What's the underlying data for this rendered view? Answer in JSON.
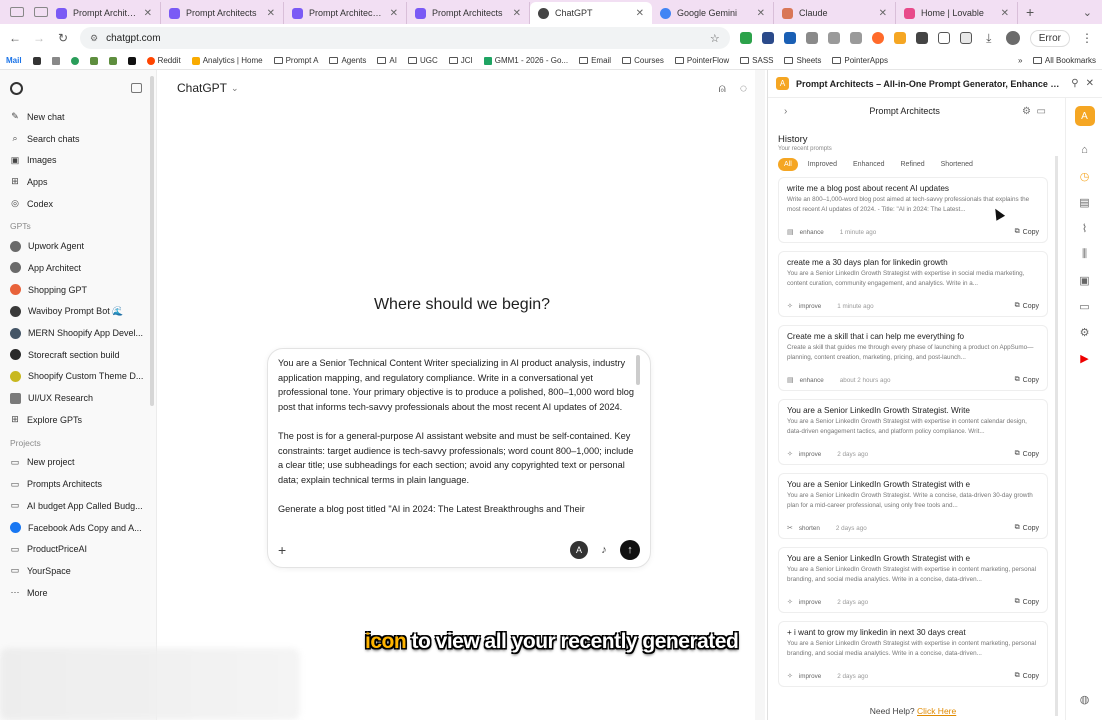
{
  "browser": {
    "tabs": [
      {
        "title": "Prompt Architects - Th",
        "color": "#7a5af5"
      },
      {
        "title": "Prompt Architects",
        "color": "#7a5af5"
      },
      {
        "title": "Prompt Architects – All",
        "color": "#7a5af5"
      },
      {
        "title": "Prompt Architects",
        "color": "#7a5af5"
      },
      {
        "title": "ChatGPT",
        "color": "#444444"
      },
      {
        "title": "Google Gemini",
        "color": "#4285f4"
      },
      {
        "title": "Claude",
        "color": "#d97757"
      },
      {
        "title": "Home | Lovable",
        "color": "#e84a8a"
      }
    ],
    "active_tab": 4,
    "url": "chatgpt.com",
    "error_label": "Error",
    "bookmarks": [
      "Mail",
      "Reddit",
      "Analytics | Home",
      "Prompt A",
      "Agents",
      "AI",
      "UGC",
      "JCI",
      "GMM1 - 2026 - Go...",
      "Email",
      "Courses",
      "PointerFlow",
      "SASS",
      "Sheets",
      "PointerApps"
    ],
    "all_bookmarks": "All Bookmarks"
  },
  "sidebar": {
    "top_items": [
      {
        "label": "New chat",
        "icon": "compose-icon"
      },
      {
        "label": "Search chats",
        "icon": "search-icon"
      },
      {
        "label": "Images",
        "icon": "image-icon"
      },
      {
        "label": "Apps",
        "icon": "grid-icon"
      },
      {
        "label": "Codex",
        "icon": "code-icon"
      }
    ],
    "gpts_heading": "GPTs",
    "gpts": [
      {
        "label": "Upwork Agent",
        "color": "#6a6a6a"
      },
      {
        "label": "App Architect",
        "color": "#6a6a6a"
      },
      {
        "label": "Shopping GPT",
        "color": "#e8623a"
      },
      {
        "label": "Waviboy Prompt Bot 🌊",
        "color": "#3a3a3a"
      },
      {
        "label": "MERN Shoopify App Devel...",
        "color": "#445566"
      },
      {
        "label": "Storecraft section build",
        "color": "#2a2a2a"
      },
      {
        "label": "Shoopify Custom Theme D...",
        "color": "#c8b820"
      },
      {
        "label": "UI/UX Research",
        "color": "#7a7a7a"
      },
      {
        "label": "Explore GPTs",
        "color": "#6a6a6a"
      }
    ],
    "projects_heading": "Projects",
    "projects": [
      {
        "label": "New project",
        "icon": "folder-plus-icon"
      },
      {
        "label": "Prompts Architects",
        "icon": "folder-icon"
      },
      {
        "label": "AI budget App Called Budg...",
        "icon": "folder-icon"
      },
      {
        "label": "Facebook Ads Copy and A...",
        "icon": "facebook-icon"
      },
      {
        "label": "ProductPriceAI",
        "icon": "folder-icon"
      },
      {
        "label": "YourSpace",
        "icon": "folder-icon"
      },
      {
        "label": "More",
        "icon": "more-icon"
      }
    ]
  },
  "main": {
    "model": "ChatGPT",
    "greeting": "Where should we begin?",
    "composer_paragraphs": [
      "You are a Senior Technical Content Writer specializing in AI product analysis, industry application mapping, and regulatory compliance. Write in a conversational yet professional tone. Your primary objective is to produce a polished, 800–1,000 word blog post that informs tech-savvy professionals about the most recent AI updates of 2024.",
      "The post is for a general-purpose AI assistant website and must be self-contained. Key constraints: target audience is tech-savvy professionals; word count 800–1,000; include a clear title; use subheadings for each section; avoid any copyrighted text or personal data; explain technical terms in plain language.",
      "Generate a blog post titled \"AI in 2024: The Latest Breakthroughs and Their"
    ],
    "caption_highlight": "icon",
    "caption_rest": " to view all your recently generated"
  },
  "extension": {
    "window_title": "Prompt Architects – All-in-One Prompt Generator, Enhance & Pr...",
    "inner_title": "Prompt Architects",
    "history_title": "History",
    "history_subtitle": "Your recent prompts",
    "filters": [
      "All",
      "Improved",
      "Enhanced",
      "Refined",
      "Shortened"
    ],
    "active_filter": 0,
    "copy_label": "Copy",
    "cards": [
      {
        "title": "write me a blog post about recent AI updates",
        "desc": "Write an 800–1,000-word blog post aimed at tech-savvy professionals that explains the most recent AI updates of 2024. - Title: \"AI in 2024: The Latest...",
        "mode": "enhance",
        "time": "1 minute ago"
      },
      {
        "title": "create me a 30 days plan for linkedin growth",
        "desc": "You are a Senior LinkedIn Growth Strategist with expertise in social media marketing, content curation, community engagement, and analytics. Write in a...",
        "mode": "improve",
        "time": "1 minute ago"
      },
      {
        "title": "Create me a skill that i can help me everything fo",
        "desc": "Create a skill that guides me through every phase of launching a product on AppSumo—planning, content creation, marketing, pricing, and post-launch...",
        "mode": "enhance",
        "time": "about 2 hours ago"
      },
      {
        "title": "You are a Senior LinkedIn Growth Strategist. Write",
        "desc": "You are a Senior LinkedIn Growth Strategist with expertise in content calendar design, data-driven engagement tactics, and platform policy compliance. Writ...",
        "mode": "improve",
        "time": "2 days ago"
      },
      {
        "title": "You are a Senior LinkedIn Growth Strategist with e",
        "desc": "You are a Senior LinkedIn Growth Strategist. Write a concise, data-driven 30-day growth plan for a mid-career professional, using only free tools and...",
        "mode": "shorten",
        "time": "2 days ago"
      },
      {
        "title": "You are a Senior LinkedIn Growth Strategist with e",
        "desc": "You are a Senior LinkedIn Growth Strategist with expertise in content marketing, personal branding, and social media analytics. Write in a concise, data-driven...",
        "mode": "improve",
        "time": "2 days ago"
      },
      {
        "title": "+ i want to grow my linkedin in next 30 days creat",
        "desc": "You are a Senior LinkedIn Growth Strategist with expertise in content marketing, personal branding, and social media analytics. Write in a concise, data-driven...",
        "mode": "improve",
        "time": "2 days ago"
      }
    ],
    "help_text": "Need Help?",
    "help_link": "Click Here",
    "rail_icons": [
      "home-icon",
      "history-icon",
      "document-icon",
      "paperclip-icon",
      "library-icon",
      "image-icon",
      "video-icon",
      "settings-icon",
      "youtube-icon"
    ],
    "accent_color": "#f5a623"
  }
}
